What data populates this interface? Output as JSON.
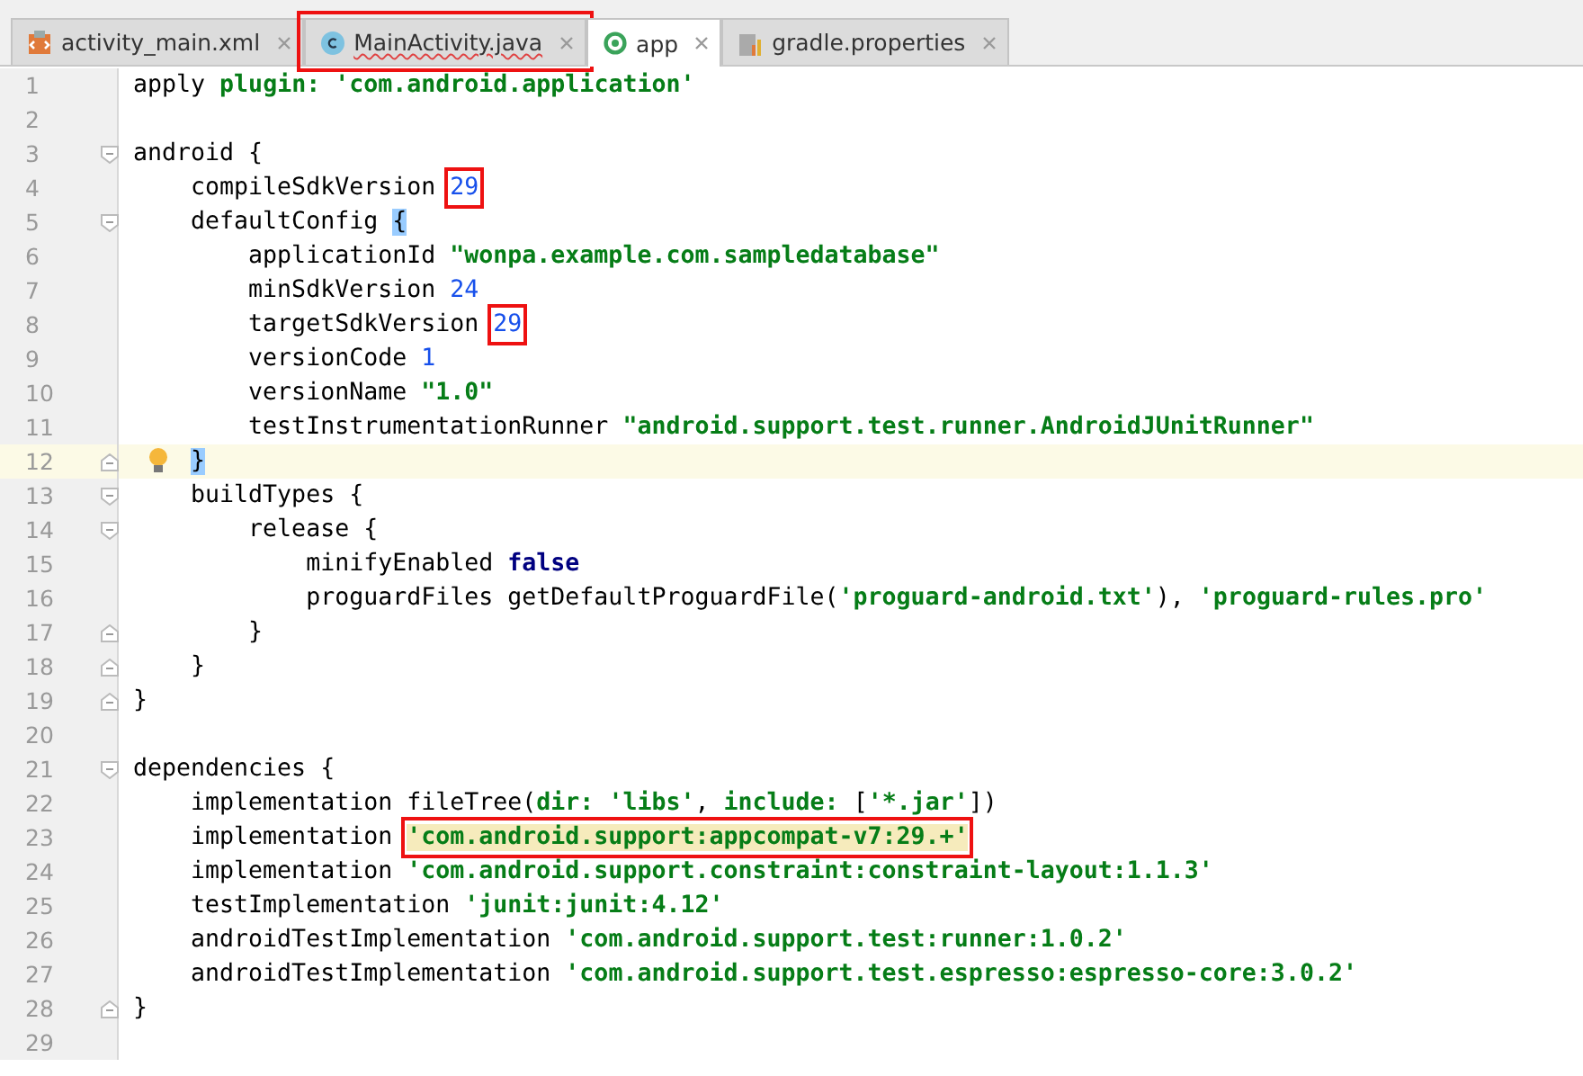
{
  "tabs": [
    {
      "label": "activity_main.xml",
      "kind": "xml",
      "selected": false
    },
    {
      "label": "MainActivity.java",
      "kind": "class",
      "selected": false,
      "error": true,
      "boxed": true
    },
    {
      "label": "app",
      "kind": "gradle",
      "selected": true
    },
    {
      "label": "gradle.properties",
      "kind": "properties",
      "selected": false
    }
  ],
  "editor": {
    "lines": [
      {
        "number": "1",
        "tokens": [
          {
            "text": "apply ",
            "kind": "plain"
          },
          {
            "text": "plugin: ",
            "kind": "named"
          },
          {
            "text": "'com.android.application'",
            "kind": "string"
          }
        ]
      },
      {
        "number": "2"
      },
      {
        "number": "3",
        "fold_start": true,
        "tokens": [
          {
            "text": "android {",
            "kind": "plain"
          }
        ]
      },
      {
        "number": "4",
        "tokens": [
          {
            "text": "    compileSdkVersion ",
            "kind": "plain"
          },
          {
            "text": "29",
            "kind": "number",
            "boxed": true
          }
        ]
      },
      {
        "number": "5",
        "fold_start": true,
        "tokens": [
          {
            "text": "    defaultConfig ",
            "kind": "plain"
          },
          {
            "text": "{",
            "kind": "plain",
            "match": true
          }
        ]
      },
      {
        "number": "6",
        "tokens": [
          {
            "text": "        applicationId ",
            "kind": "plain"
          },
          {
            "text": "\"wonpa.example.com.sampledatabase\"",
            "kind": "string"
          }
        ]
      },
      {
        "number": "7",
        "tokens": [
          {
            "text": "        minSdkVersion ",
            "kind": "plain"
          },
          {
            "text": "24",
            "kind": "number"
          }
        ]
      },
      {
        "number": "8",
        "tokens": [
          {
            "text": "        targetSdkVersion ",
            "kind": "plain"
          },
          {
            "text": "29",
            "kind": "number",
            "boxed": true
          }
        ]
      },
      {
        "number": "9",
        "tokens": [
          {
            "text": "        versionCode ",
            "kind": "plain"
          },
          {
            "text": "1",
            "kind": "number"
          }
        ]
      },
      {
        "number": "10",
        "tokens": [
          {
            "text": "        versionName ",
            "kind": "plain"
          },
          {
            "text": "\"1.0\"",
            "kind": "string"
          }
        ]
      },
      {
        "number": "11",
        "tokens": [
          {
            "text": "        testInstrumentationRunner ",
            "kind": "plain"
          },
          {
            "text": "\"android.support.test.runner.AndroidJUnitRunner\"",
            "kind": "string"
          }
        ]
      },
      {
        "number": "12",
        "fold_end": true,
        "current": true,
        "bulb": true,
        "tokens": [
          {
            "text": "    }",
            "kind": "plain",
            "match": true
          }
        ]
      },
      {
        "number": "13",
        "fold_start": true,
        "tokens": [
          {
            "text": "    buildTypes {",
            "kind": "plain"
          }
        ]
      },
      {
        "number": "14",
        "fold_start": true,
        "tokens": [
          {
            "text": "        release {",
            "kind": "plain"
          }
        ]
      },
      {
        "number": "15",
        "tokens": [
          {
            "text": "            minifyEnabled ",
            "kind": "plain"
          },
          {
            "text": "false",
            "kind": "keyword"
          }
        ]
      },
      {
        "number": "16",
        "tokens": [
          {
            "text": "            proguardFiles getDefaultProguardFile(",
            "kind": "plain"
          },
          {
            "text": "'proguard-android.txt'",
            "kind": "string"
          },
          {
            "text": "), ",
            "kind": "plain"
          },
          {
            "text": "'proguard-rules.pro'",
            "kind": "string"
          }
        ]
      },
      {
        "number": "17",
        "fold_end": true,
        "tokens": [
          {
            "text": "        }",
            "kind": "plain"
          }
        ]
      },
      {
        "number": "18",
        "fold_end": true,
        "tokens": [
          {
            "text": "    }",
            "kind": "plain"
          }
        ]
      },
      {
        "number": "19",
        "fold_end": true,
        "tokens": [
          {
            "text": "}",
            "kind": "plain"
          }
        ]
      },
      {
        "number": "20"
      },
      {
        "number": "21",
        "fold_start": true,
        "tokens": [
          {
            "text": "dependencies {",
            "kind": "plain"
          }
        ]
      },
      {
        "number": "22",
        "tokens": [
          {
            "text": "    implementation fileTree(",
            "kind": "plain"
          },
          {
            "text": "dir: ",
            "kind": "named"
          },
          {
            "text": "'libs'",
            "kind": "string"
          },
          {
            "text": ", ",
            "kind": "plain"
          },
          {
            "text": "include: ",
            "kind": "named"
          },
          {
            "text": "[",
            "kind": "plain"
          },
          {
            "text": "'*.jar'",
            "kind": "string"
          },
          {
            "text": "])",
            "kind": "plain"
          }
        ]
      },
      {
        "number": "23",
        "tokens": [
          {
            "text": "    implementation ",
            "kind": "plain"
          },
          {
            "text": "'com.android.support:appcompat-v7:29.+'",
            "kind": "string",
            "boxed": true,
            "warning": true
          }
        ]
      },
      {
        "number": "24",
        "tokens": [
          {
            "text": "    implementation ",
            "kind": "plain"
          },
          {
            "text": "'com.android.support.constraint:constraint-layout:1.1.3'",
            "kind": "string"
          }
        ]
      },
      {
        "number": "25",
        "tokens": [
          {
            "text": "    testImplementation ",
            "kind": "plain"
          },
          {
            "text": "'junit:junit:4.12'",
            "kind": "string"
          }
        ]
      },
      {
        "number": "26",
        "tokens": [
          {
            "text": "    androidTestImplementation ",
            "kind": "plain"
          },
          {
            "text": "'com.android.support.test:runner:1.0.2'",
            "kind": "string"
          }
        ]
      },
      {
        "number": "27",
        "tokens": [
          {
            "text": "    androidTestImplementation ",
            "kind": "plain"
          },
          {
            "text": "'com.android.support.test.espresso:espresso-core:3.0.2'",
            "kind": "string"
          }
        ]
      },
      {
        "number": "28",
        "fold_end": true,
        "tokens": [
          {
            "text": "}",
            "kind": "plain"
          }
        ]
      },
      {
        "number": "29"
      }
    ]
  }
}
